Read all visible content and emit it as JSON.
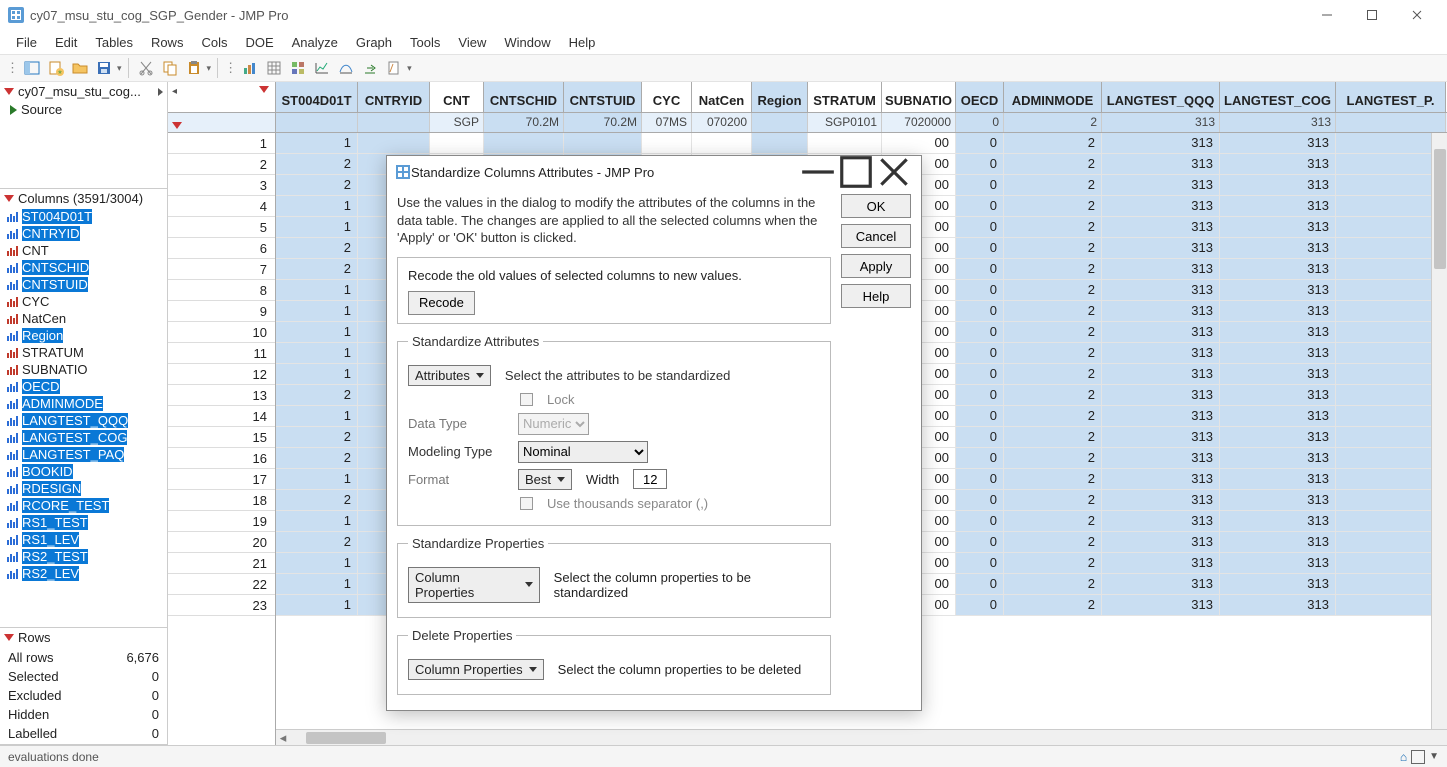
{
  "titlebar": {
    "title": "cy07_msu_stu_cog_SGP_Gender - JMP Pro"
  },
  "menu": [
    "File",
    "Edit",
    "Tables",
    "Rows",
    "Cols",
    "DOE",
    "Analyze",
    "Graph",
    "Tools",
    "View",
    "Window",
    "Help"
  ],
  "leftpanel": {
    "tab_label": "cy07_msu_stu_cog...",
    "source_label": "Source",
    "columns_header": "Columns (3591/3004)",
    "columns": [
      {
        "label": "ST004D01T",
        "color": "blue",
        "sel": true
      },
      {
        "label": "CNTRYID",
        "color": "blue",
        "sel": true
      },
      {
        "label": "CNT",
        "color": "red",
        "sel": false
      },
      {
        "label": "CNTSCHID",
        "color": "blue",
        "sel": true
      },
      {
        "label": "CNTSTUID",
        "color": "blue",
        "sel": true
      },
      {
        "label": "CYC",
        "color": "red",
        "sel": false
      },
      {
        "label": "NatCen",
        "color": "red",
        "sel": false
      },
      {
        "label": "Region",
        "color": "blue",
        "sel": true
      },
      {
        "label": "STRATUM",
        "color": "red",
        "sel": false
      },
      {
        "label": "SUBNATIO",
        "color": "red",
        "sel": false
      },
      {
        "label": "OECD",
        "color": "blue",
        "sel": true
      },
      {
        "label": "ADMINMODE",
        "color": "blue",
        "sel": true
      },
      {
        "label": "LANGTEST_QQQ",
        "color": "blue",
        "sel": true
      },
      {
        "label": "LANGTEST_COG",
        "color": "blue",
        "sel": true
      },
      {
        "label": "LANGTEST_PAQ",
        "color": "blue",
        "sel": true
      },
      {
        "label": "BOOKID",
        "color": "blue",
        "sel": true
      },
      {
        "label": "RDESIGN",
        "color": "blue",
        "sel": true
      },
      {
        "label": "RCORE_TEST",
        "color": "blue",
        "sel": true
      },
      {
        "label": "RS1_TEST",
        "color": "blue",
        "sel": true
      },
      {
        "label": "RS1_LEV",
        "color": "blue",
        "sel": true
      },
      {
        "label": "RS2_TEST",
        "color": "blue",
        "sel": true
      },
      {
        "label": "RS2_LEV",
        "color": "blue",
        "sel": true
      }
    ],
    "rows_header": "Rows",
    "rows": [
      {
        "k": "All rows",
        "v": "6,676"
      },
      {
        "k": "Selected",
        "v": "0"
      },
      {
        "k": "Excluded",
        "v": "0"
      },
      {
        "k": "Hidden",
        "v": "0"
      },
      {
        "k": "Labelled",
        "v": "0"
      }
    ]
  },
  "grid": {
    "columns": [
      {
        "name": "ST004D01T",
        "sel": true,
        "filter": "",
        "w": "w-st004"
      },
      {
        "name": "CNTRYID",
        "sel": true,
        "filter": "",
        "w": "w-cntryid"
      },
      {
        "name": "CNT",
        "sel": false,
        "filter": "SGP",
        "w": "w-cnt"
      },
      {
        "name": "CNTSCHID",
        "sel": true,
        "filter": "70.2M",
        "w": "w-cntschid"
      },
      {
        "name": "CNTSTUID",
        "sel": true,
        "filter": "70.2M",
        "w": "w-cntstuid"
      },
      {
        "name": "CYC",
        "sel": false,
        "filter": "07MS",
        "w": "w-cyc"
      },
      {
        "name": "NatCen",
        "sel": false,
        "filter": "070200",
        "w": "w-natcen"
      },
      {
        "name": "Region",
        "sel": true,
        "filter": "",
        "w": "w-region"
      },
      {
        "name": "STRATUM",
        "sel": false,
        "filter": "SGP0101",
        "w": "w-stratum"
      },
      {
        "name": "SUBNATIO",
        "sel": false,
        "filter": "7020000",
        "w": "w-subnatio"
      },
      {
        "name": "OECD",
        "sel": true,
        "filter": "0",
        "w": "w-oecd"
      },
      {
        "name": "ADMINMODE",
        "sel": true,
        "filter": "2",
        "w": "w-adminmode"
      },
      {
        "name": "LANGTEST_QQQ",
        "sel": true,
        "filter": "313",
        "w": "w-langqqq"
      },
      {
        "name": "LANGTEST_COG",
        "sel": true,
        "filter": "313",
        "w": "w-langcog"
      },
      {
        "name": "LANGTEST_P.",
        "sel": true,
        "filter": "",
        "w": "w-langp"
      }
    ],
    "rows": [
      {
        "n": 1,
        "c": [
          "1",
          "",
          "",
          "",
          "",
          "",
          "",
          "",
          "",
          "00",
          "0",
          "2",
          "313",
          "313",
          ""
        ]
      },
      {
        "n": 2,
        "c": [
          "2",
          "",
          "",
          "",
          "",
          "",
          "",
          "",
          "",
          "00",
          "0",
          "2",
          "313",
          "313",
          ""
        ]
      },
      {
        "n": 3,
        "c": [
          "2",
          "",
          "",
          "",
          "",
          "",
          "",
          "",
          "",
          "00",
          "0",
          "2",
          "313",
          "313",
          ""
        ]
      },
      {
        "n": 4,
        "c": [
          "1",
          "",
          "",
          "",
          "",
          "",
          "",
          "",
          "",
          "00",
          "0",
          "2",
          "313",
          "313",
          ""
        ]
      },
      {
        "n": 5,
        "c": [
          "1",
          "",
          "",
          "",
          "",
          "",
          "",
          "",
          "",
          "00",
          "0",
          "2",
          "313",
          "313",
          ""
        ]
      },
      {
        "n": 6,
        "c": [
          "2",
          "",
          "",
          "",
          "",
          "",
          "",
          "",
          "",
          "00",
          "0",
          "2",
          "313",
          "313",
          ""
        ]
      },
      {
        "n": 7,
        "c": [
          "2",
          "",
          "",
          "",
          "",
          "",
          "",
          "",
          "",
          "00",
          "0",
          "2",
          "313",
          "313",
          ""
        ]
      },
      {
        "n": 8,
        "c": [
          "1",
          "",
          "",
          "",
          "",
          "",
          "",
          "",
          "",
          "00",
          "0",
          "2",
          "313",
          "313",
          ""
        ]
      },
      {
        "n": 9,
        "c": [
          "1",
          "",
          "",
          "",
          "",
          "",
          "",
          "",
          "",
          "00",
          "0",
          "2",
          "313",
          "313",
          ""
        ]
      },
      {
        "n": 10,
        "c": [
          "1",
          "",
          "",
          "",
          "",
          "",
          "",
          "",
          "",
          "00",
          "0",
          "2",
          "313",
          "313",
          ""
        ]
      },
      {
        "n": 11,
        "c": [
          "1",
          "",
          "",
          "",
          "",
          "",
          "",
          "",
          "",
          "00",
          "0",
          "2",
          "313",
          "313",
          ""
        ]
      },
      {
        "n": 12,
        "c": [
          "1",
          "",
          "",
          "",
          "",
          "",
          "",
          "",
          "",
          "00",
          "0",
          "2",
          "313",
          "313",
          ""
        ]
      },
      {
        "n": 13,
        "c": [
          "2",
          "",
          "",
          "",
          "",
          "",
          "",
          "",
          "",
          "00",
          "0",
          "2",
          "313",
          "313",
          ""
        ]
      },
      {
        "n": 14,
        "c": [
          "1",
          "",
          "",
          "",
          "",
          "",
          "",
          "",
          "",
          "00",
          "0",
          "2",
          "313",
          "313",
          ""
        ]
      },
      {
        "n": 15,
        "c": [
          "2",
          "",
          "",
          "",
          "",
          "",
          "",
          "",
          "",
          "00",
          "0",
          "2",
          "313",
          "313",
          ""
        ]
      },
      {
        "n": 16,
        "c": [
          "2",
          "",
          "",
          "",
          "",
          "",
          "",
          "",
          "",
          "00",
          "0",
          "2",
          "313",
          "313",
          ""
        ]
      },
      {
        "n": 17,
        "c": [
          "1",
          "",
          "",
          "",
          "",
          "",
          "",
          "",
          "",
          "00",
          "0",
          "2",
          "313",
          "313",
          ""
        ]
      },
      {
        "n": 18,
        "c": [
          "2",
          "",
          "",
          "",
          "",
          "",
          "",
          "",
          "",
          "00",
          "0",
          "2",
          "313",
          "313",
          ""
        ]
      },
      {
        "n": 19,
        "c": [
          "1",
          "",
          "",
          "",
          "",
          "",
          "",
          "",
          "",
          "00",
          "0",
          "2",
          "313",
          "313",
          ""
        ]
      },
      {
        "n": 20,
        "c": [
          "2",
          "",
          "",
          "",
          "",
          "",
          "",
          "",
          "",
          "00",
          "0",
          "2",
          "313",
          "313",
          ""
        ]
      },
      {
        "n": 21,
        "c": [
          "1",
          "",
          "",
          "",
          "",
          "",
          "",
          "",
          "",
          "00",
          "0",
          "2",
          "313",
          "313",
          ""
        ]
      },
      {
        "n": 22,
        "c": [
          "1",
          "",
          "",
          "",
          "",
          "",
          "",
          "",
          "",
          "00",
          "0",
          "2",
          "313",
          "313",
          ""
        ]
      },
      {
        "n": 23,
        "c": [
          "1",
          "",
          "",
          "",
          "",
          "",
          "",
          "",
          "",
          "00",
          "0",
          "2",
          "313",
          "313",
          ""
        ]
      }
    ]
  },
  "dialog": {
    "title": "Standardize Columns Attributes - JMP Pro",
    "intro": "Use the values in the dialog to modify the attributes of the columns in the data table. The changes are applied to all the selected columns when the 'Apply' or 'OK' button is clicked.",
    "recode_text": "Recode the old values of selected columns to new values.",
    "recode_btn": "Recode",
    "std_attr_legend": "Standardize Attributes",
    "attributes_btn": "Attributes",
    "attributes_hint": "Select the attributes to be standardized",
    "lock_label": "Lock",
    "datatype_label": "Data Type",
    "datatype_value": "Numeric",
    "modeling_label": "Modeling Type",
    "modeling_value": "Nominal",
    "format_label": "Format",
    "format_value": "Best",
    "width_label": "Width",
    "width_value": "12",
    "thousands_label": "Use thousands separator (,)",
    "std_props_legend": "Standardize Properties",
    "colprops_btn": "Column Properties",
    "std_props_hint": "Select the column properties to be standardized",
    "del_props_legend": "Delete Properties",
    "del_props_hint": "Select the column properties to be deleted",
    "ok": "OK",
    "cancel": "Cancel",
    "apply": "Apply",
    "help": "Help"
  },
  "statusbar": {
    "text": "evaluations done"
  }
}
